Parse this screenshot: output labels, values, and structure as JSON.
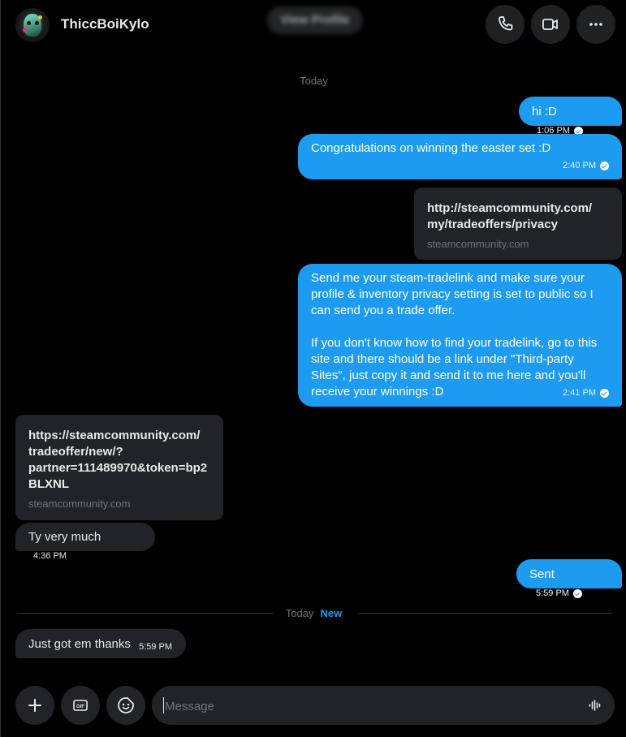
{
  "header": {
    "name": "ThiccBoiKylo",
    "view_profile_label": "View Profile",
    "icons": [
      "phone-icon",
      "video-icon",
      "more-icon"
    ]
  },
  "separators": {
    "top_day": "Today",
    "new_day": "Today",
    "new_label": "New"
  },
  "messages": [
    {
      "dir": "out",
      "type": "text",
      "text": "hi :D",
      "time": "1:06 PM",
      "read": true
    },
    {
      "dir": "out",
      "type": "text",
      "text": "Congratulations on winning the easter set :D",
      "time": "2:40 PM",
      "read": true
    },
    {
      "dir": "out",
      "type": "link",
      "url": "http://steamcommunity.com/my/tradeoffers/privacy",
      "url_lines": [
        "http://steamcommunity.com/",
        "my/tradeoffers/privacy"
      ],
      "domain": "steamcommunity.com"
    },
    {
      "dir": "out",
      "type": "text",
      "text": "Send me your steam-tradelink and make sure your profile & inventory privacy setting is set to public so I can send you a trade offer.\n\nIf you don't know how to find your tradelink, go to this site and there should be a link under \"Third-party Sites\", just copy it and send it to me here and you'll receive your winnings :D",
      "time": "2:41 PM",
      "read": true
    },
    {
      "dir": "in",
      "type": "link",
      "url": "https://steamcommunity.com/tradeoffer/new/?partner=111489970&token=bp2BLXNL",
      "url_lines": [
        "https://steamcommunity.com/",
        "tradeoffer/new/?",
        "partner=111489970&token=bp2",
        "BLXNL"
      ],
      "domain": "steamcommunity.com"
    },
    {
      "dir": "in",
      "type": "text",
      "text": "Ty very much",
      "time": "4:36 PM"
    },
    {
      "dir": "out",
      "type": "text",
      "text": "Sent",
      "time": "5:59 PM",
      "read": true
    },
    {
      "dir": "in",
      "type": "text",
      "text": "Just got em thanks",
      "time": "5:59 PM"
    }
  ],
  "composer": {
    "placeholder": "Message",
    "add_label": "+",
    "gif_label": "GIF"
  },
  "colors": {
    "accent": "#1d9bf0",
    "incoming_bubble": "#202327",
    "background": "#000000"
  }
}
